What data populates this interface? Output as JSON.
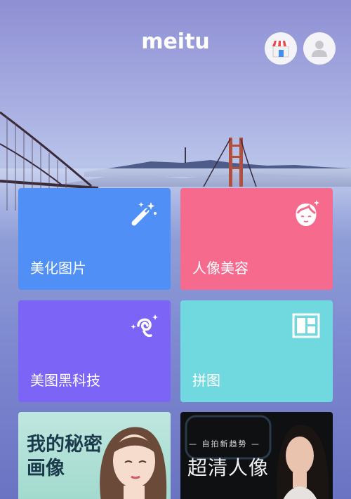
{
  "header": {
    "logo_text": "meitu",
    "store_icon": "store-icon",
    "profile_icon": "user-avatar-icon"
  },
  "tiles": [
    {
      "label": "美化图片",
      "icon": "magic-wand-icon",
      "color": "#4f8ff6"
    },
    {
      "label": "人像美容",
      "icon": "face-sparkle-icon",
      "color": "#f66b8d"
    },
    {
      "label": "美图黑科技",
      "icon": "sparkle-swirl-icon",
      "color": "#7c64f6"
    },
    {
      "label": "拼图",
      "icon": "collage-icon",
      "color": "#6fd9df"
    }
  ],
  "banners": [
    {
      "title": "我的秘密画像"
    },
    {
      "subtitle": "— 自拍新趋势 —",
      "title": "超清人像"
    }
  ]
}
